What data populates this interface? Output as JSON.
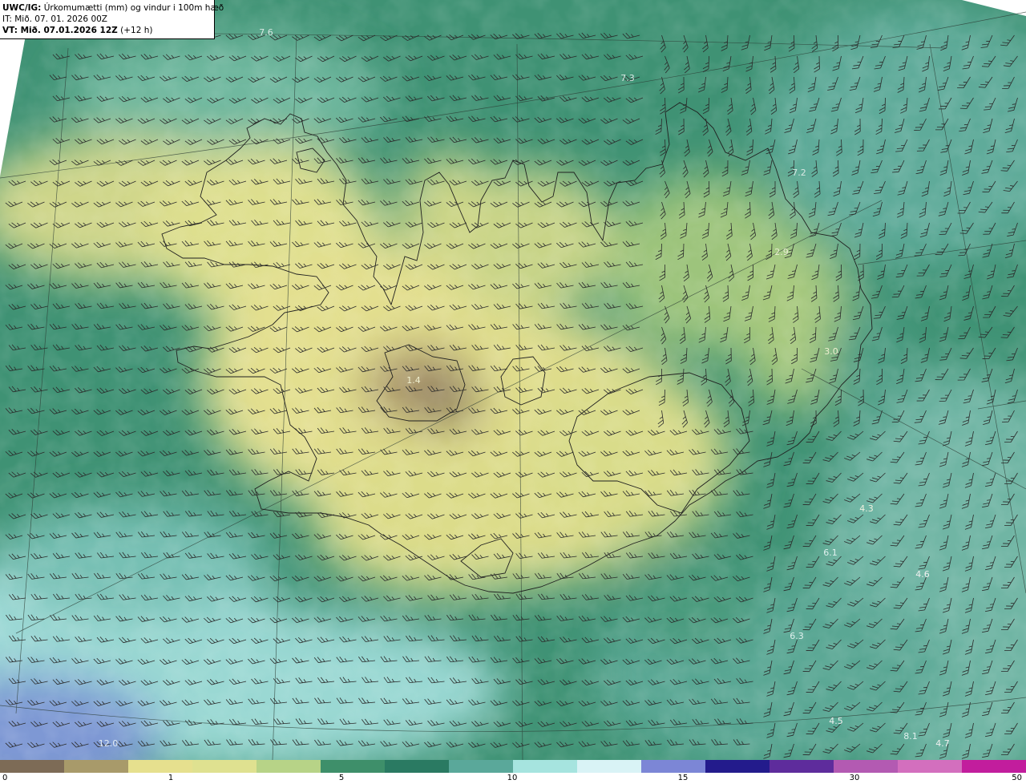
{
  "header": {
    "line1_bold": "UWC/IG:",
    "line1_text": " Úrkomumætti (mm) og vindur i 100m hæð",
    "line2": "IT: Mið. 07. 01. 2026 00Z",
    "line3_bold": "VT: Mið. 07.01.2026 12Z",
    "line3_text": " (+12 h)"
  },
  "map_labels": [
    {
      "text": "7.6",
      "color": "#d9e8e4"
    },
    {
      "text": "7.3",
      "color": "#d9e8e4"
    },
    {
      "text": "7.2",
      "color": "#d9e8e4"
    },
    {
      "text": "2.9",
      "color": "#e8ecd0"
    },
    {
      "text": "3.0",
      "color": "#f0f0d0"
    },
    {
      "text": "1.4",
      "color": "#f0f0d0"
    },
    {
      "text": "4.3",
      "color": "#f0f0e0"
    },
    {
      "text": "6.1",
      "color": "#e0f0ee"
    },
    {
      "text": "4.6",
      "color": "#f0f0f0"
    },
    {
      "text": "6.3",
      "color": "#e0f0ee"
    },
    {
      "text": "4.5",
      "color": "#f0f0f0"
    },
    {
      "text": "4.7",
      "color": "#f0f0f0"
    },
    {
      "text": "12.0",
      "color": "#e0eaf4"
    },
    {
      "text": "8.1",
      "color": "#e0f0ee"
    }
  ],
  "colorbar": {
    "ticks": [
      "0",
      "1",
      "5",
      "10",
      "15",
      "30",
      "50"
    ],
    "colors": [
      "#7d6b56",
      "#a89a6a",
      "#e6e08e",
      "#dfe190",
      "#b7d387",
      "#3e8f6a",
      "#2a7a62",
      "#5aa89a",
      "#a6e4df",
      "#d9f3f6",
      "#7c86d6",
      "#231b8c",
      "#5e2c9c",
      "#b35ab2",
      "#d36fbe",
      "#c21d9d"
    ]
  },
  "wind_barbs_icon": "wind-barb-icon"
}
